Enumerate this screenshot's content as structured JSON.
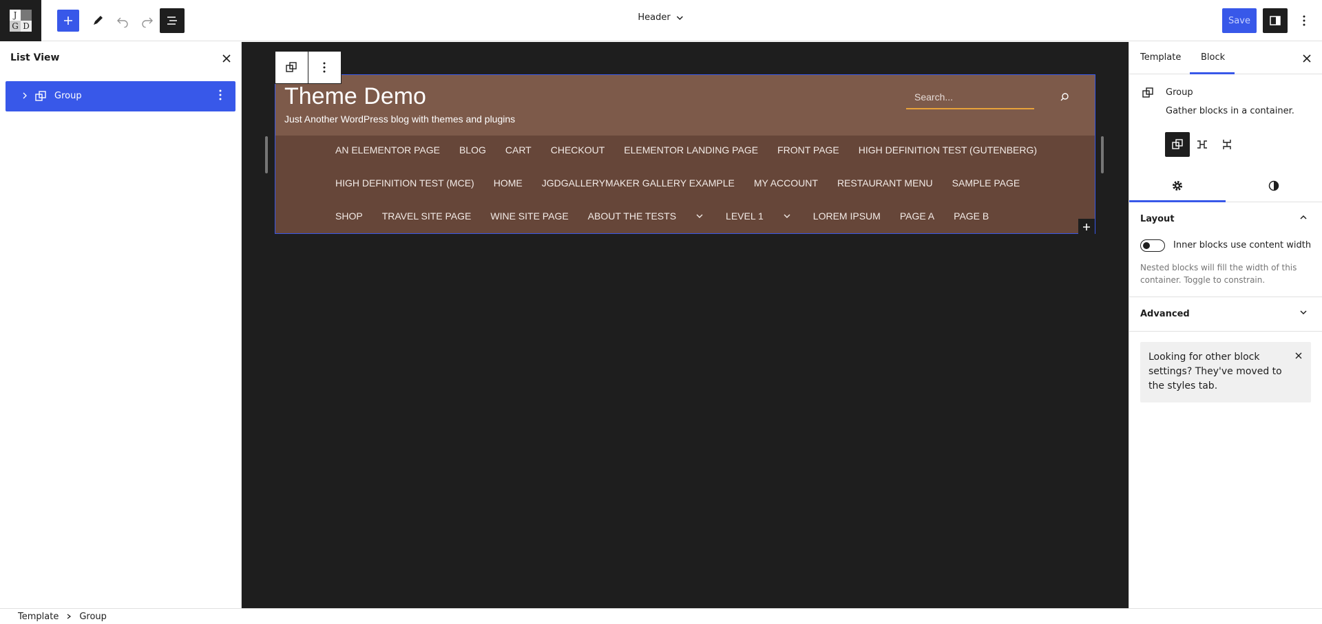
{
  "topbar": {
    "logo_letters": [
      "J",
      "",
      "G",
      "D"
    ],
    "document_title": "Header",
    "save_label": "Save"
  },
  "list_view": {
    "title": "List View",
    "items": [
      {
        "label": "Group"
      }
    ]
  },
  "canvas": {
    "site_title": "Theme Demo",
    "site_tagline": "Just Another WordPress blog with themes and plugins",
    "search_placeholder": "Search...",
    "nav_rows": [
      [
        "AN ELEMENTOR PAGE",
        "BLOG",
        "CART",
        "CHECKOUT",
        "ELEMENTOR LANDING PAGE",
        "FRONT PAGE",
        "HIGH DEFINITION TEST (GUTENBERG)"
      ],
      [
        "HIGH DEFINITION TEST (MCE)",
        "HOME",
        "JGDGALLERYMAKER GALLERY EXAMPLE",
        "MY ACCOUNT",
        "RESTAURANT MENU",
        "SAMPLE PAGE"
      ],
      [
        "SHOP",
        "TRAVEL SITE PAGE",
        "WINE SITE PAGE",
        "ABOUT THE TESTS",
        "LEVEL 1",
        "LOREM IPSUM",
        "PAGE A",
        "PAGE B"
      ]
    ],
    "colors": {
      "header_top": "#7d5a4a",
      "header_nav": "#664639",
      "search_underline": "#e8a23a",
      "accent": "#3858e9"
    }
  },
  "sidebar": {
    "tabs": [
      "Template",
      "Block"
    ],
    "active_tab": "Block",
    "block_name": "Group",
    "block_description": "Gather blocks in a container.",
    "layout_title": "Layout",
    "toggle_label": "Inner blocks use content width",
    "toggle_on": false,
    "layout_help": "Nested blocks will fill the width of this container. Toggle to constrain.",
    "advanced_title": "Advanced",
    "notice_text": "Looking for other block settings? They've moved to the styles tab."
  },
  "footer": {
    "breadcrumb": [
      "Template",
      "Group"
    ]
  }
}
